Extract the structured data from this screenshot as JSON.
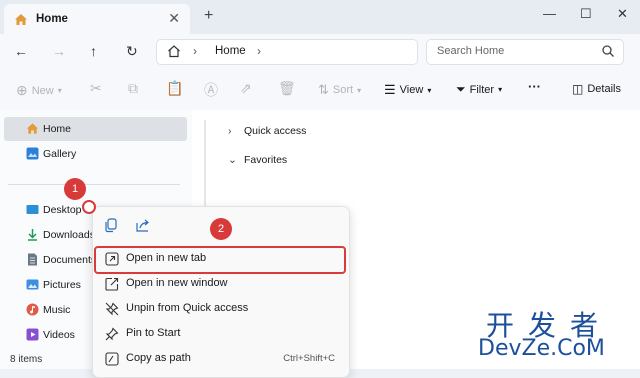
{
  "tab": {
    "title": "Home",
    "new_tab_symbol": "+"
  },
  "window_controls": {
    "minimize": "—",
    "maximize": "☐",
    "close": "✕"
  },
  "address": {
    "location": "Home"
  },
  "search": {
    "placeholder": "Search Home"
  },
  "toolbar": {
    "new_label": "New",
    "sort_label": "Sort",
    "view_label": "View",
    "filter_label": "Filter",
    "more_label": "···",
    "details_label": "Details"
  },
  "sidebar": {
    "items": [
      {
        "label": "Home",
        "icon": "home-icon"
      },
      {
        "label": "Gallery",
        "icon": "gallery-icon"
      },
      {
        "label": "Desktop",
        "icon": "desktop-icon"
      },
      {
        "label": "Downloads",
        "icon": "download-icon"
      },
      {
        "label": "Documents",
        "icon": "documents-icon"
      },
      {
        "label": "Pictures",
        "icon": "pictures-icon"
      },
      {
        "label": "Music",
        "icon": "music-icon"
      },
      {
        "label": "Videos",
        "icon": "videos-icon"
      }
    ]
  },
  "status": {
    "items_count": "8 items"
  },
  "main": {
    "sections": [
      {
        "label": "Quick access",
        "chevron": "›"
      },
      {
        "label": "Favorites",
        "chevron": "⌄"
      }
    ]
  },
  "context_menu": {
    "items": [
      {
        "label": "Open in new tab",
        "shortcut": ""
      },
      {
        "label": "Open in new window",
        "shortcut": ""
      },
      {
        "label": "Unpin from Quick access",
        "shortcut": ""
      },
      {
        "label": "Pin to Start",
        "shortcut": ""
      },
      {
        "label": "Copy as path",
        "shortcut": "Ctrl+Shift+C"
      }
    ]
  },
  "annotations": {
    "step1": "1",
    "step2": "2"
  },
  "watermark": {
    "cn": "开发者",
    "en": "DevZe.CoM"
  },
  "colors": {
    "highlight": "#d93a3a",
    "accent": "#0067c0",
    "watermark": "#1d4f9a"
  }
}
